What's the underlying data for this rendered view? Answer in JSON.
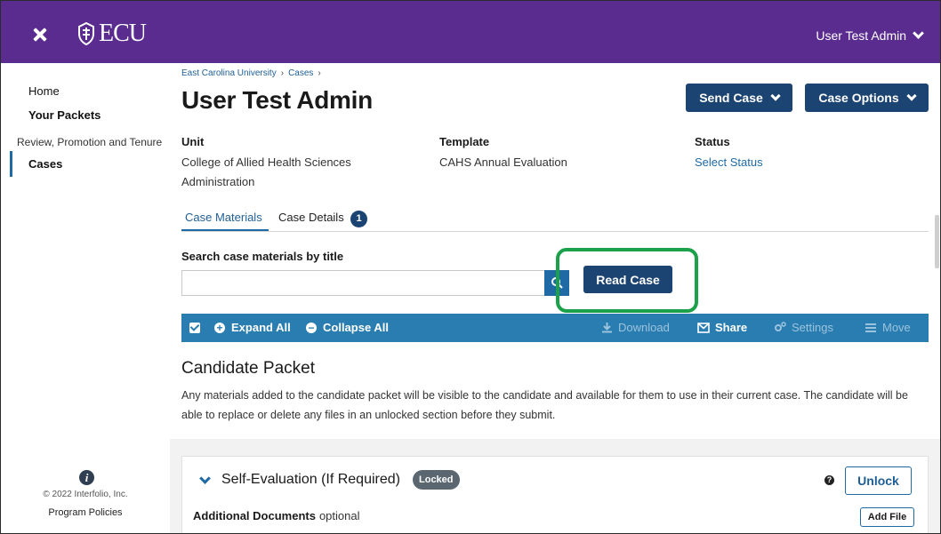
{
  "topbar": {
    "logo_text": "ECU",
    "user_menu_label": "User Test Admin"
  },
  "sidebar": {
    "items": [
      {
        "label": "Home"
      },
      {
        "label": "Your Packets"
      },
      {
        "label": "Review, Promotion and Tenure"
      },
      {
        "label": "Cases"
      }
    ],
    "copyright": "© 2022 Interfolio, Inc.",
    "policies_link": "Program Policies"
  },
  "breadcrumb": {
    "items": [
      "East Carolina University",
      "Cases"
    ],
    "separator": "›"
  },
  "page": {
    "title": "User Test Admin",
    "send_case_label": "Send Case",
    "case_options_label": "Case Options"
  },
  "meta": {
    "unit_label": "Unit",
    "unit_value": "College of Allied Health Sciences Administration",
    "template_label": "Template",
    "template_value": "CAHS Annual Evaluation",
    "status_label": "Status",
    "status_value": "Select Status"
  },
  "tabs": {
    "materials_label": "Case Materials",
    "details_label": "Case Details",
    "details_badge": "1"
  },
  "search": {
    "label": "Search case materials by title",
    "value": "",
    "placeholder": "",
    "read_case_label": "Read Case"
  },
  "toolbar": {
    "expand_all": "Expand All",
    "collapse_all": "Collapse All",
    "download": "Download",
    "share": "Share",
    "settings": "Settings",
    "move": "Move"
  },
  "packet": {
    "title": "Candidate Packet",
    "description": "Any materials added to the candidate packet will be visible to the candidate and available for them to use in their current case. The candidate will be able to replace or delete any files in an unlocked section before they submit."
  },
  "section_card": {
    "title": "Self-Evaluation (If Required)",
    "badge": "Locked",
    "unlock_label": "Unlock",
    "docs_label": "Additional Documents",
    "docs_optional": "optional",
    "add_file_label": "Add File"
  },
  "colors": {
    "header_purple": "#5b2c8f",
    "primary_navy": "#1c4473",
    "toolbar_blue": "#2a7db0",
    "link_blue": "#1f6aa5",
    "highlight_green": "#1aa14a"
  }
}
